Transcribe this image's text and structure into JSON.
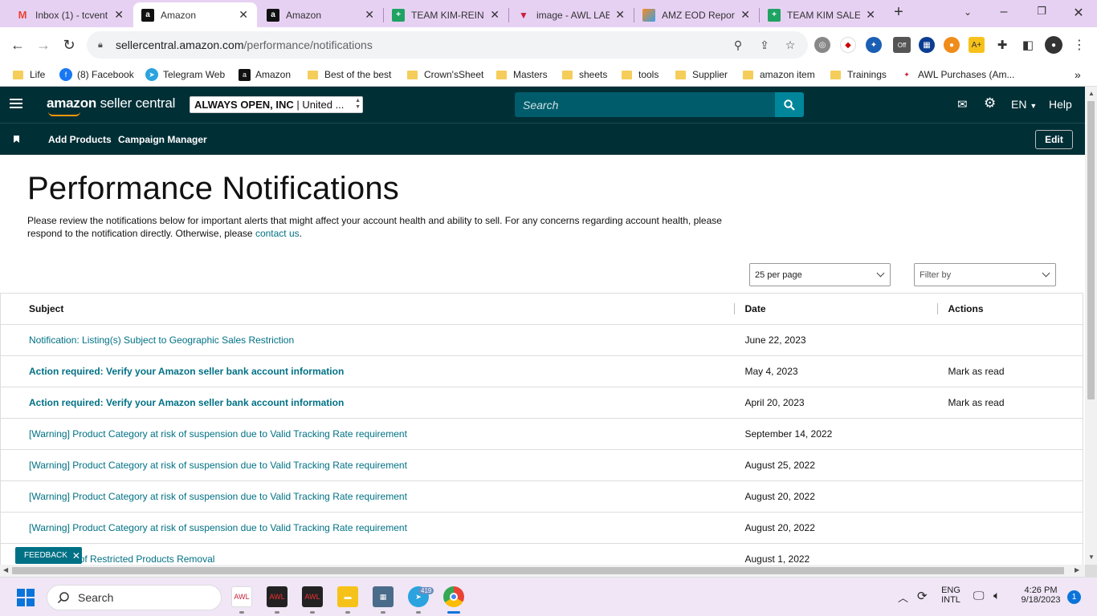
{
  "browser": {
    "tabs": [
      {
        "title": "Inbox (1) - tcvent",
        "icon": "gmail-icon"
      },
      {
        "title": "Amazon",
        "icon": "amazon-icon"
      },
      {
        "title": "Amazon",
        "icon": "amazon-icon"
      },
      {
        "title": "TEAM KIM-REINE",
        "icon": "sheets-icon"
      },
      {
        "title": "image - AWL LAB",
        "icon": "awl-icon"
      },
      {
        "title": "AMZ EOD Report",
        "icon": "eod-icon"
      },
      {
        "title": "TEAM KIM SALES",
        "icon": "sheets-icon"
      }
    ],
    "url_host": "sellercentral.amazon.com",
    "url_path": "/performance/notifications",
    "bookmarks": [
      {
        "label": "Life",
        "type": "folder"
      },
      {
        "label": "(8) Facebook",
        "type": "site"
      },
      {
        "label": "Telegram Web",
        "type": "site"
      },
      {
        "label": "Amazon",
        "type": "site"
      },
      {
        "label": "Best of the best",
        "type": "folder"
      },
      {
        "label": "Crown'sSheet",
        "type": "folder"
      },
      {
        "label": "Masters",
        "type": "folder"
      },
      {
        "label": "sheets",
        "type": "folder"
      },
      {
        "label": "tools",
        "type": "folder"
      },
      {
        "label": "Supplier",
        "type": "folder"
      },
      {
        "label": "amazon item",
        "type": "folder"
      },
      {
        "label": "Trainings",
        "type": "folder"
      },
      {
        "label": "AWL Purchases (Am...",
        "type": "site"
      }
    ],
    "ext_badge": "Off"
  },
  "sc": {
    "logo_bold": "amazon",
    "logo_rest": " seller central",
    "account": "ALWAYS OPEN, INC",
    "account_market": " | United ...",
    "search_placeholder": "Search",
    "lang": "EN",
    "help": "Help",
    "subnav": [
      "Add Products",
      "Campaign Manager"
    ],
    "edit": "Edit"
  },
  "page": {
    "title": "Performance Notifications",
    "description": "Please review the notifications below for important alerts that might affect your account health and ability to sell. For any concerns regarding account health, please respond to the notification directly. Otherwise, please ",
    "contact_link": "contact us",
    "per_page": "25 per page",
    "filter_placeholder": "Filter by",
    "columns": {
      "subject": "Subject",
      "date": "Date",
      "actions": "Actions"
    },
    "rows": [
      {
        "subject": "Notification: Listing(s) Subject to Geographic Sales Restriction",
        "date": "June 22, 2023",
        "action": "",
        "bold": false
      },
      {
        "subject": "Action required: Verify your Amazon seller bank account information",
        "date": "May 4, 2023",
        "action": "Mark as read",
        "bold": true
      },
      {
        "subject": "Action required: Verify your Amazon seller bank account information",
        "date": "April 20, 2023",
        "action": "Mark as read",
        "bold": true
      },
      {
        "subject": "[Warning] Product Category at risk of suspension due to Valid Tracking Rate requirement",
        "date": "September 14, 2022",
        "action": "",
        "bold": false
      },
      {
        "subject": "[Warning] Product Category at risk of suspension due to Valid Tracking Rate requirement",
        "date": "August 25, 2022",
        "action": "",
        "bold": false
      },
      {
        "subject": "[Warning] Product Category at risk of suspension due to Valid Tracking Rate requirement",
        "date": "August 20, 2022",
        "action": "",
        "bold": false
      },
      {
        "subject": "[Warning] Product Category at risk of suspension due to Valid Tracking Rate requirement",
        "date": "August 20, 2022",
        "action": "",
        "bold": false
      },
      {
        "subject": "Notification of Restricted Products Removal",
        "date": "August 1, 2022",
        "action": "",
        "bold": false
      }
    ],
    "feedback": "FEEDBACK"
  },
  "taskbar": {
    "search": "Search",
    "telegram_badge": "419",
    "lang_top": "ENG",
    "lang_bottom": "INTL",
    "time": "4:26 PM",
    "date": "9/18/2023",
    "notifications": "1"
  }
}
